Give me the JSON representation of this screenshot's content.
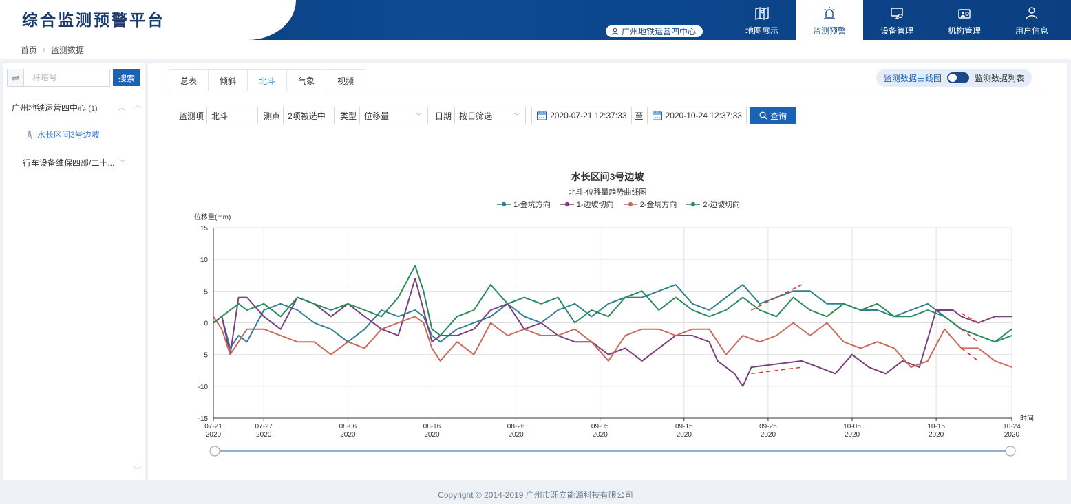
{
  "app": {
    "title": "综合监测预警平台",
    "org": "广州地铁运营四中心"
  },
  "nav": [
    {
      "label": "地图展示",
      "icon": "map-icon"
    },
    {
      "label": "监测预警",
      "icon": "alarm-icon"
    },
    {
      "label": "设备管理",
      "icon": "monitor-icon"
    },
    {
      "label": "机构管理",
      "icon": "org-card-icon"
    },
    {
      "label": "用户信息",
      "icon": "user-icon"
    }
  ],
  "breadcrumb": {
    "home": "首页",
    "current": "监测数据"
  },
  "sidebar": {
    "search_placeholder": "杆塔号",
    "search_label": "搜索",
    "group1": {
      "label": "广州地铁运营四中心",
      "count": "(1)"
    },
    "leaf": "水长区间3号边坡",
    "group2": {
      "label": "行车设备维保四部/二十..."
    }
  },
  "tabs": [
    "总表",
    "倾斜",
    "北斗",
    "气象",
    "视频"
  ],
  "view_toggle": {
    "left": "监测数据曲线图",
    "right": "监测数据列表"
  },
  "filters": {
    "item_label": "监测项",
    "item_value": "北斗",
    "point_label": "测点",
    "point_value": "2项被选中",
    "type_label": "类型",
    "type_value": "位移量",
    "date_label": "日期",
    "date_value": "按日筛选",
    "start": "2020-07-21 12:37:33",
    "to": "至",
    "end": "2020-10-24 12:37:33",
    "query_label": "查询"
  },
  "chart_data": {
    "type": "line",
    "title": "水长区间3号边坡",
    "subtitle": "北斗-位移量趋势曲线图",
    "ylabel": "位移量(mm)",
    "xlabel": "时间",
    "ylim": [
      -15,
      15
    ],
    "yticks": [
      15,
      10,
      5,
      0,
      -5,
      -10,
      -15
    ],
    "xlim_days": [
      0,
      95
    ],
    "x_date_ticks": [
      "07-21 2020",
      "07-27 2020",
      "08-06 2020",
      "08-16 2020",
      "08-26 2020",
      "09-05 2020",
      "09-15 2020",
      "09-25 2020",
      "10-05 2020",
      "10-15 2020",
      "10-24 2020"
    ],
    "grid": true,
    "legend": "top-center",
    "series": [
      {
        "name": "1-金坑方向",
        "color": "#2e8191",
        "x": [
          "07-21",
          "07-22",
          "07-23",
          "07-24",
          "07-25",
          "07-27",
          "07-29",
          "07-31",
          "08-02",
          "08-04",
          "08-06",
          "08-08",
          "08-10",
          "08-12",
          "08-14",
          "08-15",
          "08-16",
          "08-17",
          "08-19",
          "08-21",
          "08-23",
          "08-25",
          "08-27",
          "08-29",
          "08-31",
          "09-02",
          "09-04",
          "09-06",
          "09-08",
          "09-10",
          "09-12",
          "09-14",
          "09-16",
          "09-18",
          "09-20",
          "09-22",
          "09-24",
          "09-26",
          "09-28",
          "09-30",
          "10-02",
          "10-04",
          "10-06",
          "10-08",
          "10-10",
          "10-12",
          "10-14",
          "10-16",
          "10-18",
          "10-20",
          "10-22",
          "10-24"
        ],
        "y": [
          0,
          1,
          -4,
          -2,
          -3,
          2,
          3,
          2,
          0,
          -1,
          -3,
          -1,
          2,
          1,
          2,
          1,
          -2,
          -3,
          -1,
          0,
          1,
          3,
          1,
          0,
          2,
          3,
          1,
          3,
          4,
          4,
          5,
          6,
          3,
          2,
          4,
          6,
          3,
          4,
          5,
          5,
          3,
          3,
          2,
          2,
          1,
          2,
          3,
          1,
          -1,
          -2,
          -3,
          -1
        ]
      },
      {
        "name": "1-边坡切向",
        "color": "#7b3f7d",
        "x": [
          "07-21",
          "07-22",
          "07-23",
          "07-24",
          "07-25",
          "07-27",
          "07-29",
          "07-31",
          "08-02",
          "08-04",
          "08-06",
          "08-08",
          "08-10",
          "08-12",
          "08-14",
          "08-15",
          "08-16",
          "08-17",
          "08-19",
          "08-21",
          "08-23",
          "08-25",
          "08-27",
          "08-29",
          "08-31",
          "09-02",
          "09-04",
          "09-06",
          "09-08",
          "09-10",
          "09-12",
          "09-14",
          "09-16",
          "09-18",
          "09-19",
          "09-21",
          "09-22",
          "09-23",
          "09-29",
          "10-01",
          "10-03",
          "10-05",
          "10-07",
          "10-09",
          "10-11",
          "10-13",
          "10-15",
          "10-17",
          "10-18",
          "10-20",
          "10-22",
          "10-24"
        ],
        "y": [
          0,
          1,
          -5,
          4,
          4,
          1,
          -1,
          4,
          3,
          1,
          3,
          1,
          -1,
          -2,
          7,
          2,
          -3,
          -2,
          -2,
          -1,
          2,
          3,
          -1,
          0,
          -2,
          -3,
          -3,
          -5,
          -4,
          -6,
          -4,
          -2,
          -2,
          -3,
          -6,
          -8,
          -10,
          -7,
          -6,
          -7,
          -8,
          -5,
          -7,
          -8,
          -6,
          -7,
          2,
          2,
          1,
          0,
          1,
          1
        ]
      },
      {
        "name": "2-金坑方向",
        "color": "#c96a5c",
        "x": [
          "07-21",
          "07-22",
          "07-23",
          "07-24",
          "07-25",
          "07-27",
          "07-29",
          "07-31",
          "08-02",
          "08-04",
          "08-06",
          "08-08",
          "08-10",
          "08-12",
          "08-14",
          "08-15",
          "08-16",
          "08-17",
          "08-19",
          "08-21",
          "08-23",
          "08-25",
          "08-27",
          "08-29",
          "08-31",
          "09-02",
          "09-04",
          "09-06",
          "09-08",
          "09-10",
          "09-12",
          "09-14",
          "09-16",
          "09-18",
          "09-20",
          "09-22",
          "09-24",
          "09-26",
          "09-28",
          "09-30",
          "10-02",
          "10-04",
          "10-06",
          "10-08",
          "10-10",
          "10-12",
          "10-14",
          "10-16",
          "10-18",
          "10-20",
          "10-22",
          "10-24"
        ],
        "y": [
          1,
          -1,
          -5,
          -3,
          -1,
          -1,
          -2,
          -3,
          -3,
          -5,
          -3,
          -4,
          -1,
          0,
          1,
          0,
          -4,
          -6,
          -3,
          -5,
          0,
          -2,
          -1,
          -2,
          -2,
          -1,
          -3,
          -6,
          -2,
          -1,
          -1,
          -2,
          -1,
          -1,
          -5,
          -2,
          -3,
          -2,
          0,
          -2,
          0,
          -3,
          -4,
          -3,
          -4,
          -7,
          -6,
          -1,
          -4,
          -4,
          -6,
          -7
        ]
      },
      {
        "name": "2-边坡切向",
        "color": "#2a8a5a",
        "x": [
          "07-21",
          "07-22",
          "07-23",
          "07-24",
          "07-25",
          "07-27",
          "07-29",
          "07-31",
          "08-02",
          "08-04",
          "08-06",
          "08-08",
          "08-10",
          "08-12",
          "08-14",
          "08-15",
          "08-16",
          "08-17",
          "08-19",
          "08-21",
          "08-23",
          "08-25",
          "08-27",
          "08-29",
          "08-31",
          "09-02",
          "09-04",
          "09-06",
          "09-08",
          "09-10",
          "09-12",
          "09-14",
          "09-16",
          "09-18",
          "09-20",
          "09-22",
          "09-24",
          "09-26",
          "09-28",
          "09-30",
          "10-02",
          "10-04",
          "10-06",
          "10-08",
          "10-10",
          "10-12",
          "10-14",
          "10-16",
          "10-18",
          "10-20",
          "10-22",
          "10-24"
        ],
        "y": [
          0,
          1,
          2,
          3,
          2,
          3,
          1,
          4,
          3,
          2,
          3,
          2,
          1,
          4,
          9,
          5,
          -1,
          -2,
          1,
          2,
          6,
          3,
          4,
          3,
          4,
          0,
          2,
          1,
          4,
          5,
          2,
          4,
          2,
          1,
          2,
          4,
          2,
          1,
          4,
          2,
          1,
          3,
          2,
          3,
          1,
          1,
          2,
          1,
          -1,
          -2,
          -3,
          -2
        ]
      }
    ],
    "gaps_dashed": [
      {
        "series": "1-金坑方向",
        "from": [
          "09-23",
          2
        ],
        "to": [
          "09-29",
          6
        ]
      },
      {
        "series": "1-边坡切向",
        "from": [
          "09-23",
          -8
        ],
        "to": [
          "09-29",
          -7
        ]
      },
      {
        "series": "1-边坡切向",
        "from": [
          "10-18",
          1.5
        ],
        "to": [
          "10-20",
          0
        ]
      },
      {
        "series": "2-金坑方向",
        "from": [
          "10-18",
          -4
        ],
        "to": [
          "10-20",
          -6
        ]
      },
      {
        "series": "2-边坡切向",
        "from": [
          "10-18",
          -1
        ],
        "to": [
          "10-20",
          -3
        ]
      }
    ]
  },
  "footer": "Copyright © 2014-2019 广州市泺立能源科技有限公司"
}
